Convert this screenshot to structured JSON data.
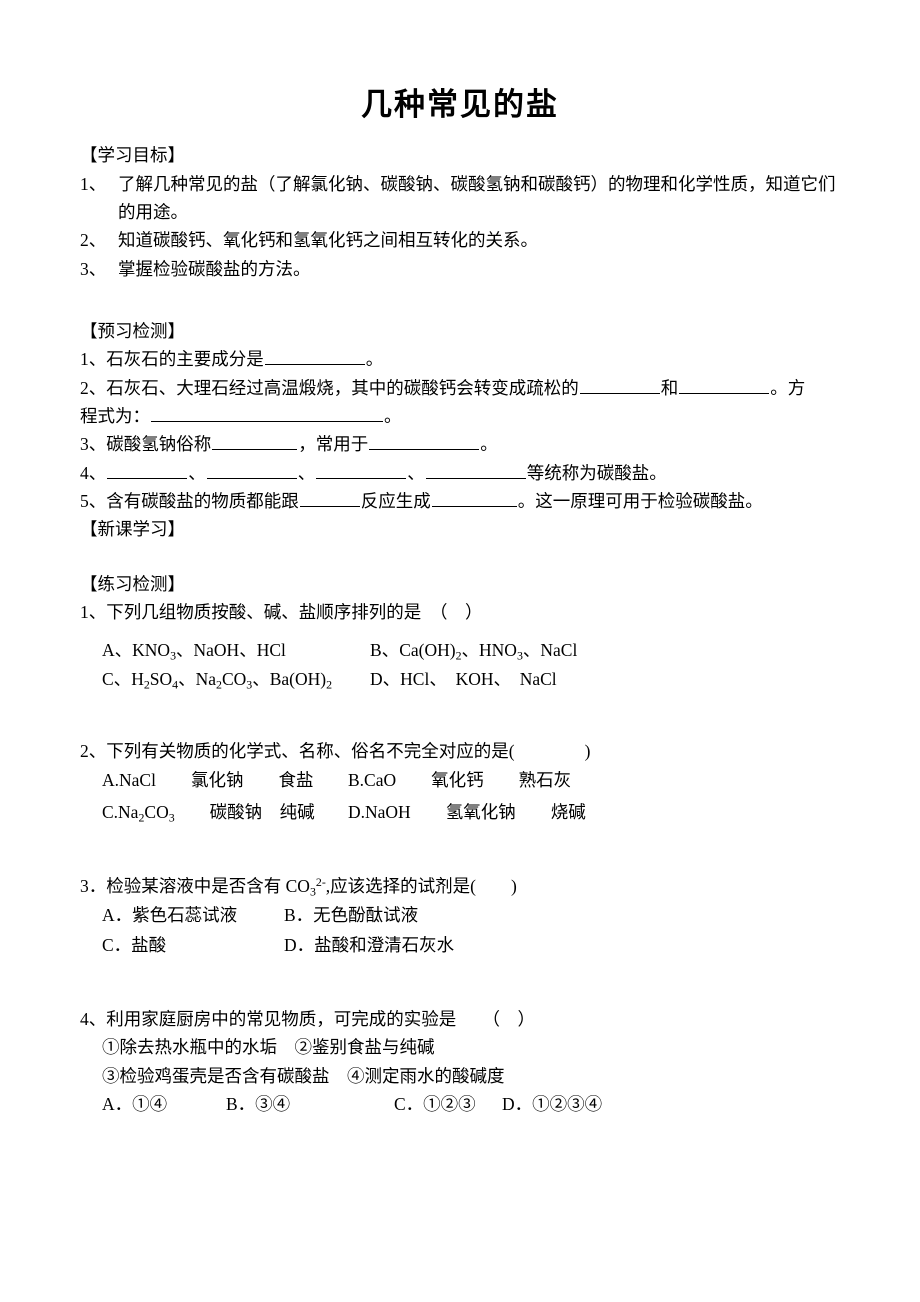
{
  "document": {
    "title": "几种常见的盐"
  },
  "sections": {
    "objectives": {
      "heading": "【学习目标】",
      "items": [
        {
          "num": "1、",
          "text": "了解几种常见的盐（了解氯化钠、碳酸钠、碳酸氢钠和碳酸钙）的物理和化学性质，知道它们的用途。"
        },
        {
          "num": "2、",
          "text": "知道碳酸钙、氧化钙和氢氧化钙之间相互转化的关系。"
        },
        {
          "num": "3、",
          "text": "掌握检验碳酸盐的方法。"
        }
      ]
    },
    "preview": {
      "heading": "【预习检测】",
      "q1": {
        "prefix": "1、石灰石的主要成分是",
        "suffix": "。"
      },
      "q2": {
        "prefix": "2、石灰石、大理石经过高温煅烧，其中的碳酸钙会转变成疏松的",
        "mid": "和",
        "suffix": "。方",
        "line2_prefix": "程式为：",
        "line2_suffix": "。"
      },
      "q3": {
        "prefix": "3、碳酸氢钠俗称",
        "mid": "，常用于",
        "suffix": "。"
      },
      "q4": {
        "prefix": "4、",
        "sep": "、",
        "suffix": "等统称为碳酸盐。"
      },
      "q5": {
        "prefix": "5、含有碳酸盐的物质都能跟",
        "mid": "反应生成",
        "suffix": "。这一原理可用于检验碳酸盐。"
      }
    },
    "new_lesson": {
      "heading": "【新课学习】"
    },
    "practice": {
      "heading": "【练习检测】",
      "questions": [
        {
          "stem": "1、下列几组物质按酸、碱、盐顺序排列的是　（　）",
          "options": [
            {
              "label": "A、",
              "formula_html": "KNO<sub>3</sub>、NaOH、HCl"
            },
            {
              "label": "B、",
              "formula_html": "Ca(OH)<sub>2</sub>、HNO<sub>3</sub>、NaCl"
            },
            {
              "label": "C、",
              "formula_html": "H<sub>2</sub>SO<sub>4</sub>、Na<sub>2</sub>CO<sub>3</sub>、Ba(OH)<sub>2</sub>"
            },
            {
              "label": "D、",
              "formula_html": "HCl、　KOH、　NaCl"
            }
          ]
        },
        {
          "stem": "2、下列有关物质的化学式、名称、俗名不完全对应的是(　　　　)",
          "options": [
            {
              "html": "A.NaCl　　氯化钠　　食盐"
            },
            {
              "html": "B.CaO　　氧化钙　　熟石灰"
            },
            {
              "html": "C.Na<sub>2</sub>CO<sub>3</sub>　　碳酸钠　纯碱"
            },
            {
              "html": "D.NaOH　　氢氧化钠　　烧碱"
            }
          ]
        },
        {
          "stem_html": "3．检验某溶液中是否含有 CO<sub>3</sub><sup>2-</sup>,应该选择的试剂是(　　)",
          "options": [
            {
              "html": "A．紫色石蕊试液"
            },
            {
              "html": "B．无色酚酞试液"
            },
            {
              "html": "C．盐酸"
            },
            {
              "html": "D．盐酸和澄清石灰水"
            }
          ]
        },
        {
          "stem": "4、利用家庭厨房中的常见物质，可完成的实验是　　（　）",
          "sub_items": [
            "①除去热水瓶中的水垢　②鉴别食盐与纯碱",
            "③检验鸡蛋壳是否含有碳酸盐　④测定雨水的酸碱度"
          ],
          "answers": [
            "A．①④",
            "B．③④",
            "C．①②③",
            "D．①②③④"
          ]
        }
      ]
    }
  }
}
